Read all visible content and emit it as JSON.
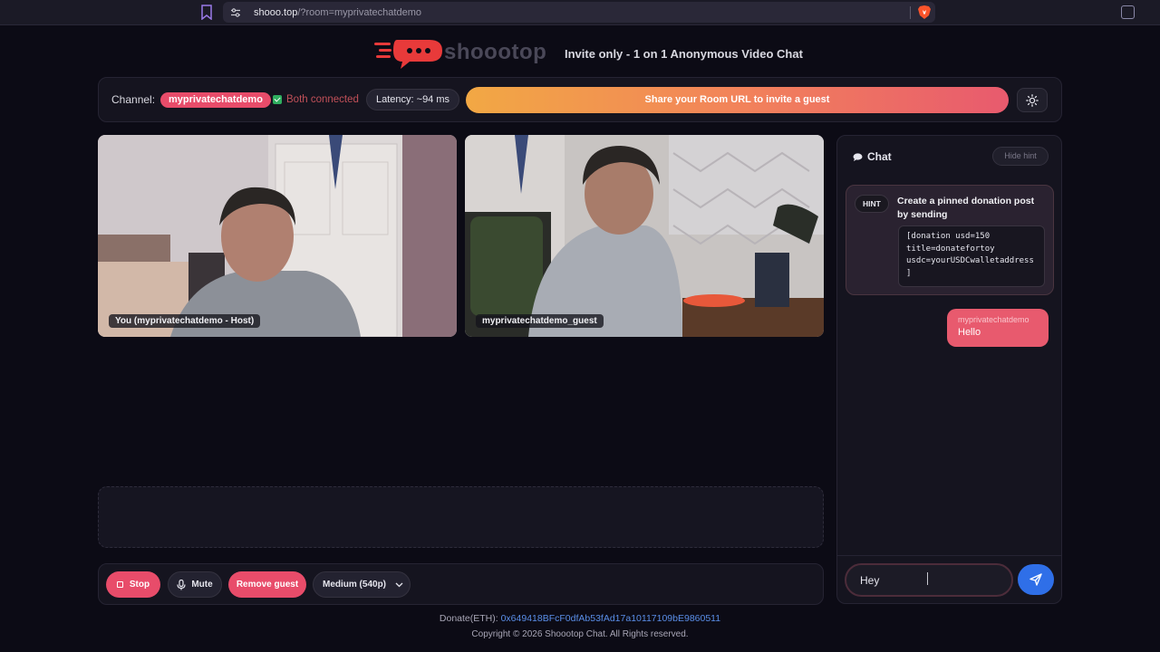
{
  "browser": {
    "url_host": "shooo.top",
    "url_path": "/?room=myprivatechatdemo"
  },
  "header": {
    "logo_text": "shoootop",
    "tagline": "Invite only - 1 on 1 Anonymous Video Chat"
  },
  "control_bar": {
    "channel_label": "Channel:",
    "channel_name": "myprivatechatdemo",
    "connection_status": "Both connected",
    "latency": "Latency: ~94 ms",
    "share_button": "Share your Room URL to invite a guest"
  },
  "videos": {
    "host_label": "You (myprivatechatdemo - Host)",
    "guest_label": "myprivatechatdemo_guest"
  },
  "controls": {
    "stop": "Stop",
    "mute": "Mute",
    "remove_guest": "Remove guest",
    "quality": "Medium (540p)"
  },
  "chat": {
    "title": "Chat",
    "hide_hint": "Hide hint",
    "hint_badge": "HINT",
    "hint_title": "Create a pinned donation post by sending",
    "hint_code": "[donation usd=150\ntitle=donatefortoy\nusdc=yourUSDCwalletaddress\n]",
    "messages": [
      {
        "sender": "myprivatechatdemo",
        "text": "Hello"
      }
    ],
    "input_value": "Hey"
  },
  "footer": {
    "donate_label": "Donate(ETH): ",
    "donate_address": "0x649418BFcF0dfAb53fAd17a10117109bE9860511",
    "copyright": "Copyright © 2026 Shoootop Chat. All Rights reserved."
  },
  "colors": {
    "accent": "#e84c6a",
    "share_gradient_start": "#f2a844",
    "share_gradient_end": "#e85a6e",
    "send": "#2f6fe8",
    "connected": "#2fae5f"
  }
}
